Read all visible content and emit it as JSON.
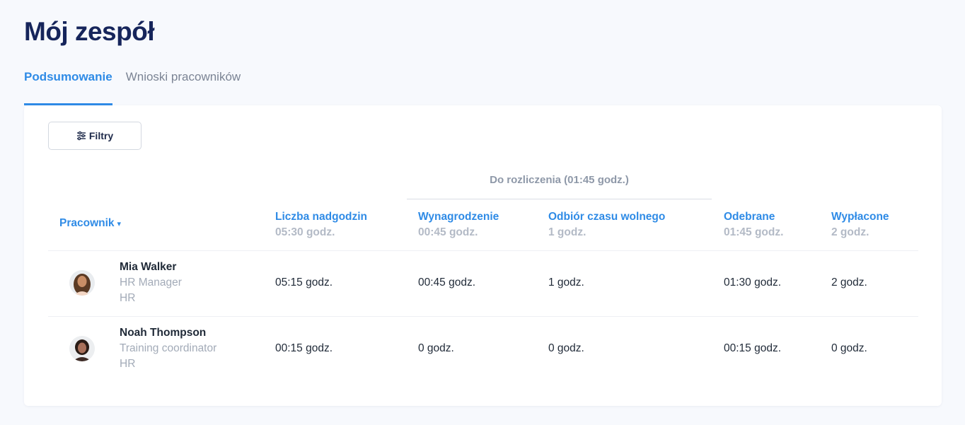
{
  "page": {
    "title": "Mój zespół"
  },
  "tabs": [
    {
      "label": "Podsumowanie",
      "active": true
    },
    {
      "label": "Wnioski pracowników",
      "active": false
    }
  ],
  "filter": {
    "label": "Filtry"
  },
  "table": {
    "group_header": "Do rozliczenia (01:45 godz.)",
    "employee_header": "Pracownik",
    "sort_indicator": "▾",
    "columns": [
      {
        "label": "Liczba nadgodzin",
        "total": "05:30 godz."
      },
      {
        "label": "Wynagrodzenie",
        "total": "00:45 godz."
      },
      {
        "label": "Odbiór czasu wolnego",
        "total": "1 godz."
      },
      {
        "label": "Odebrane",
        "total": "01:45 godz."
      },
      {
        "label": "Wypłacone",
        "total": "2 godz."
      }
    ],
    "rows": [
      {
        "name": "Mia Walker",
        "role": "HR Manager",
        "department": "HR",
        "values": [
          "05:15 godz.",
          "00:45 godz.",
          "1 godz.",
          "01:30 godz.",
          "2 godz."
        ]
      },
      {
        "name": "Noah Thompson",
        "role": "Training coordinator",
        "department": "HR",
        "values": [
          "00:15 godz.",
          "0 godz.",
          "0 godz.",
          "00:15 godz.",
          "0 godz."
        ]
      }
    ]
  },
  "colors": {
    "accent": "#2f8be6",
    "title": "#16255b",
    "muted": "#a3abb8"
  },
  "icons": {
    "filter": "sliders-icon",
    "avatar": "user-avatar"
  }
}
